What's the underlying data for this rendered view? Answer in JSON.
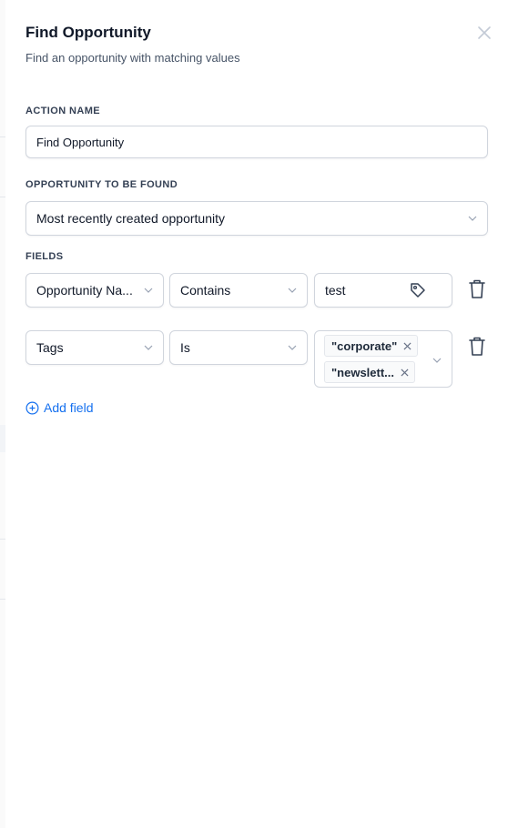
{
  "header": {
    "title": "Find Opportunity",
    "subtitle": "Find an opportunity with matching values"
  },
  "action_name": {
    "label": "ACTION NAME",
    "value": "Find Opportunity"
  },
  "opportunity": {
    "label": "OPPORTUNITY TO BE FOUND",
    "selected": "Most recently created opportunity"
  },
  "fields": {
    "label": "FIELDS",
    "rows": [
      {
        "field": "Opportunity Na...",
        "operator": "Contains",
        "value": "test"
      },
      {
        "field": "Tags",
        "operator": "Is",
        "tags": [
          "\"corporate\"",
          "\"newslett..."
        ]
      }
    ]
  },
  "add_field_label": "Add field",
  "colors": {
    "accent": "#1570ef",
    "border": "#d0d5dd",
    "text": "#101828",
    "muted": "#475467"
  },
  "icons": [
    "close-icon",
    "chevron-down-icon",
    "tag-icon",
    "trash-icon",
    "remove-chip-icon",
    "plus-circle-icon"
  ]
}
